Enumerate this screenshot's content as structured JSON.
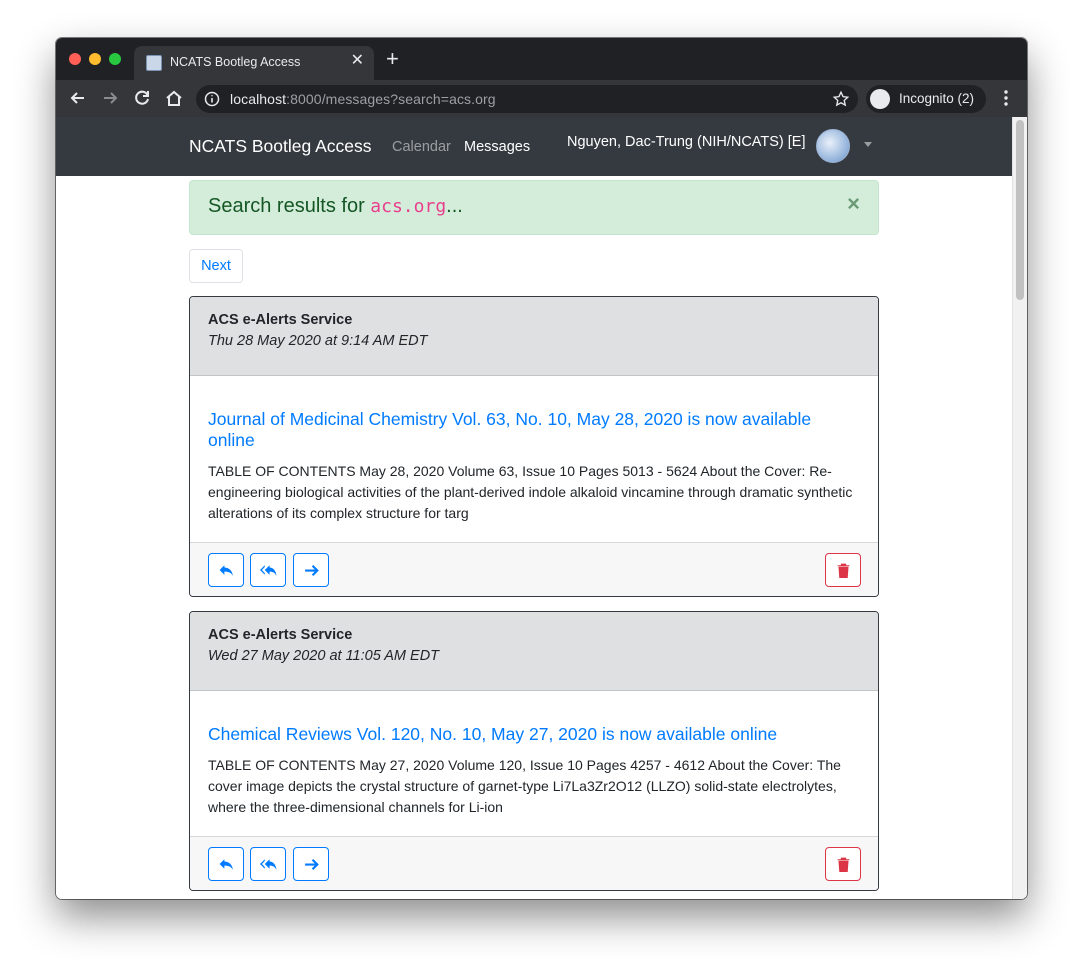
{
  "browser": {
    "tab_title": "NCATS Bootleg Access",
    "url_host": "localhost",
    "url_rest": ":8000/messages?search=acs.org",
    "incognito_label": "Incognito (2)"
  },
  "navbar": {
    "brand": "NCATS Bootleg Access",
    "links": [
      "Calendar",
      "Messages"
    ],
    "user_name": "Nguyen, Dac-Trung (NIH/NCATS) [E]"
  },
  "alert": {
    "prefix": "Search results for ",
    "query": "acs.org",
    "suffix": "...",
    "close": "×"
  },
  "pagination": {
    "next_label": "Next"
  },
  "messages": [
    {
      "sender": "ACS e-Alerts Service",
      "date": "Thu 28 May 2020 at 9:14 AM EDT",
      "subject": "Journal of Medicinal Chemistry Vol. 63, No. 10, May 28, 2020 is now available online",
      "preview": "TABLE OF CONTENTS May 28, 2020 Volume 63, Issue 10 Pages 5013 - 5624 About the Cover: Re-engineering biological activities of the plant-derived indole alkaloid vincamine through dramatic synthetic alterations of its complex structure for targ"
    },
    {
      "sender": "ACS e-Alerts Service",
      "date": "Wed 27 May 2020 at 11:05 AM EDT",
      "subject": "Chemical Reviews Vol. 120, No. 10, May 27, 2020 is now available online",
      "preview": "TABLE OF CONTENTS May 27, 2020 Volume 120, Issue 10 Pages 4257 - 4612 About the Cover: The cover image depicts the crystal structure of garnet-type Li7La3Zr2O12 (LLZO) solid-state electrolytes, where the three-dimensional channels for Li-ion"
    }
  ],
  "colors": {
    "navbar_bg": "#343a40",
    "link": "#007bff",
    "danger": "#dc3545",
    "alert_bg": "#d4edda",
    "code": "#e83e8c"
  }
}
